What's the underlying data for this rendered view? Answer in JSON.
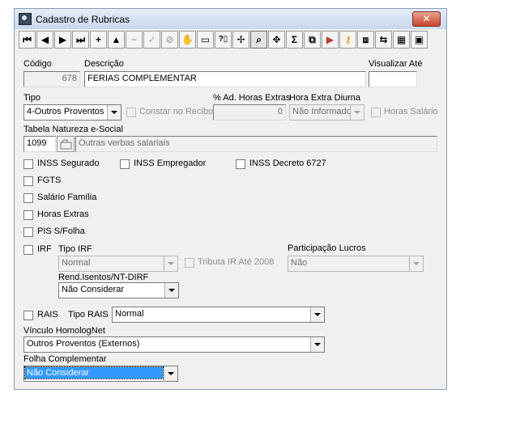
{
  "window": {
    "title": "Cadastro de Rubricas",
    "close_label": "✕"
  },
  "toolbar": {
    "first": "⏮",
    "prev": "◀",
    "next": "▶",
    "last": "⏭",
    "insert": "+",
    "edit": "▲",
    "delete": "−",
    "post": "✓",
    "cancel": "⊘",
    "b10": "✋",
    "b11": "▭",
    "b12": "?▯",
    "b13": "✢",
    "b14": "⌕",
    "b15": "✥",
    "b16": "Σ",
    "b17": "⧉",
    "b18": "▶",
    "b19": "⚷",
    "b20": "⧈",
    "b21": "⇆",
    "b22": "▦",
    "b23": "▣"
  },
  "form": {
    "codigo_label": "Código",
    "codigo_value": "678",
    "descricao_label": "Descrição",
    "descricao_value": "FERIAS COMPLEMENTAR",
    "visualizar_label": "Visualizar Até",
    "visualizar_value": "",
    "tipo_label": "Tipo",
    "tipo_value": "4-Outros Proventos",
    "constar_label": "Constar no Recibo",
    "ad_horas_label": "% Ad. Horas Extras",
    "ad_horas_value": "0",
    "hora_diurna_label": "Hora Extra Diurna",
    "hora_diurna_value": "Não Informado",
    "horas_salario_label": "Horas Salário",
    "natureza_label": "Tabela Natureza e-Social",
    "natureza_code": "1099",
    "natureza_desc": "Outras verbas salariais",
    "inss_segurado": "INSS Segurado",
    "inss_empregador": "INSS Empregador",
    "inss_decreto": "INSS Decreto 6727",
    "fgts": "FGTS",
    "salario_familia": "Salário Família",
    "horas_extras": "Horas Extras",
    "pis": "PIS S/Folha",
    "irf": "IRF",
    "tipo_irf_label": "Tipo IRF",
    "tipo_irf_value": "Normal",
    "tributa_label": "Tributa IR Até 2008",
    "participacao_label": "Participação Lucros",
    "participacao_value": "Não",
    "rend_label": "Rend.Isentos/NT-DIRF",
    "rend_value": "Não Considerar",
    "rais": "RAIS",
    "tipo_rais_label": "Tipo RAIS",
    "tipo_rais_value": "Normal",
    "vinculo_label": "Vínculo HomologNet",
    "vinculo_value": "Outros Proventos (Externos)",
    "folha_label": "Folha Complementar",
    "folha_value": "Não Considerar"
  }
}
